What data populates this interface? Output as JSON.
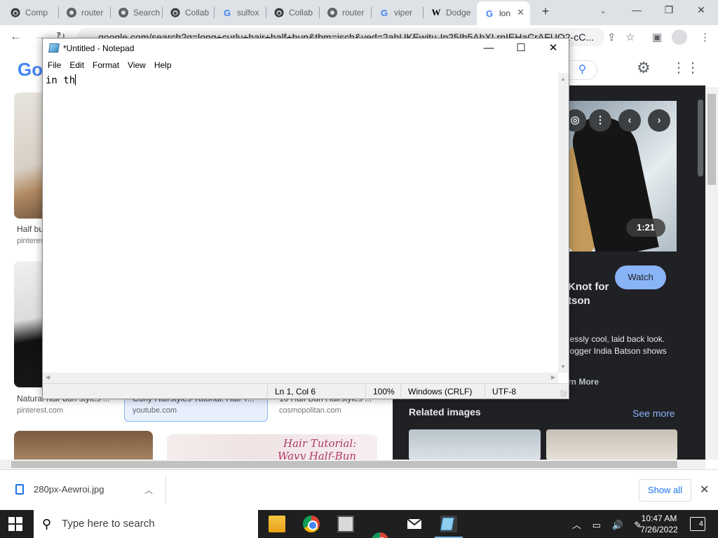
{
  "browser": {
    "tabs": [
      {
        "label": "Comp",
        "favicon": "github-icon"
      },
      {
        "label": "router",
        "favicon": "circle-icon"
      },
      {
        "label": "Search",
        "favicon": "circle-icon"
      },
      {
        "label": "Collab",
        "favicon": "github-icon"
      },
      {
        "label": "sulfox",
        "favicon": "google-icon"
      },
      {
        "label": "Collab",
        "favicon": "github-icon"
      },
      {
        "label": "router",
        "favicon": "circle-icon"
      },
      {
        "label": "viper",
        "favicon": "google-icon"
      },
      {
        "label": "Dodge",
        "favicon": "wikipedia-icon"
      },
      {
        "label": "lon",
        "favicon": "google-icon",
        "active": true
      }
    ],
    "url": "google.com/search?q=long+curly+hair+half+bun&tbm=isch&ved=2ahUKEwitu-Ip25Ib5AhXLrnIEHaCrAFUQ2-cC..."
  },
  "google": {
    "logo": "Go",
    "results": [
      {
        "caption": "Half bu",
        "source": "pinteres"
      },
      {
        "caption": "Natural hair bun styles ...",
        "source": "pinterest.com"
      },
      {
        "caption": "Curly Hairstyles Tutorial: Half T...",
        "source": "youtube.com"
      },
      {
        "caption": "10 Half Bun Hairstyles ...",
        "source": "cosmopolitan.com"
      }
    ],
    "tutorial_text": [
      "Hair Tutorial:",
      "Wavy Half-Bun"
    ],
    "panel": {
      "duration": "1:21",
      "watch_label": "Watch",
      "title_lines": [
        "Knot for",
        "tson"
      ],
      "description_lines": [
        "lessly cool, laid back look.",
        "logger India Batson shows"
      ],
      "learn_more": "rn More",
      "related_title": "Related images",
      "see_more": "See more"
    }
  },
  "notepad": {
    "title": "*Untitled - Notepad",
    "menu": [
      "File",
      "Edit",
      "View",
      "Format",
      "Help"
    ],
    "content": "in th",
    "status": {
      "position": "Ln 1, Col 6",
      "zoom": "100%",
      "line_ending": "Windows (CRLF)",
      "encoding": "UTF-8"
    }
  },
  "downloads": {
    "file": "280px-Aewroi.jpg",
    "show_all": "Show all"
  },
  "taskbar": {
    "search_placeholder": "Type here to search",
    "time": "10:47 AM",
    "date": "7/26/2022",
    "notification_count": "4"
  }
}
